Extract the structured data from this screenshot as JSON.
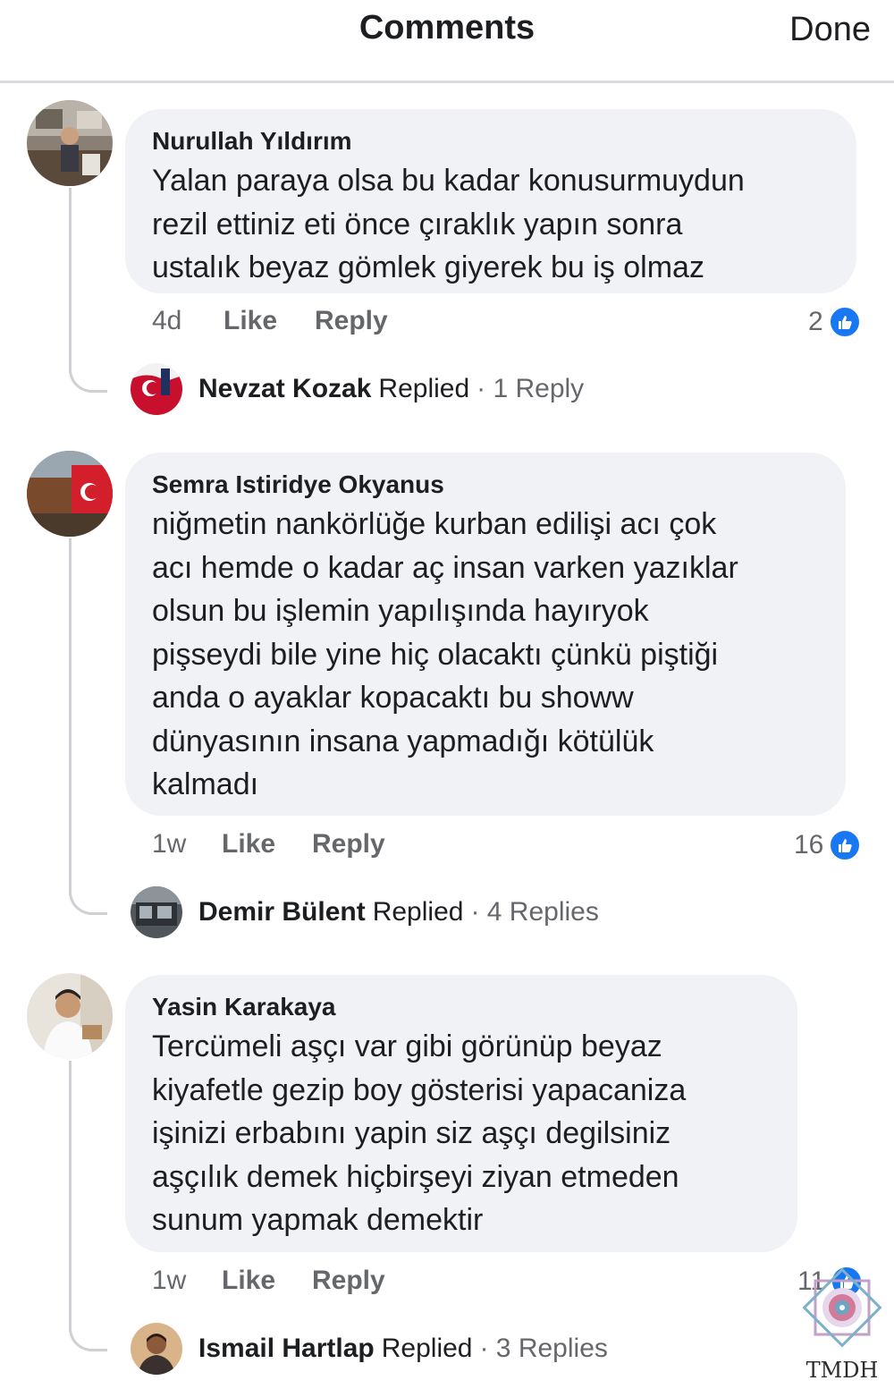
{
  "header": {
    "title": "Comments",
    "done_label": "Done"
  },
  "comments": [
    {
      "author": "Nurullah Yıldırım",
      "text": "Yalan paraya olsa bu kadar konusurmuydun\nrezil ettiniz eti önce çıraklık yapın sonra\nustalık beyaz gömlek giyerek bu iş olmaz",
      "time": "4d",
      "like_label": "Like",
      "reply_label": "Reply",
      "reaction_count": "2",
      "reply_preview": {
        "name": "Nevzat Kozak",
        "verb": "Replied",
        "count": "· 1 Reply"
      }
    },
    {
      "author": "Semra Istiridye Okyanus",
      "text": "niğmetin nankörlüğe kurban edilişi acı çok\nacı hemde o kadar aç insan varken yazıklar\nolsun bu işlemin yapılışında hayıryok\npişseydi bile yine hiç olacaktı çünkü piştiği\nanda o ayaklar kopacaktı bu showw\ndünyasının  insana yapmadığı kötülük\nkalmadı",
      "time": "1w",
      "like_label": "Like",
      "reply_label": "Reply",
      "reaction_count": "16",
      "reply_preview": {
        "name": "Demir Bülent",
        "verb": "Replied",
        "count": "· 4 Replies"
      }
    },
    {
      "author": "Yasin Karakaya",
      "text": "Tercümeli aşçı var gibi görünüp  beyaz\nkiyafetle gezip boy gösterisi yapacaniza\nişinizi erbabını yapin siz aşçı degilsiniz\naşçılık demek hiçbirşeyi ziyan etmeden\nsunum yapmak demektir",
      "time": "1w",
      "like_label": "Like",
      "reply_label": "Reply",
      "reaction_count": "11",
      "reply_preview": {
        "name": "Ismail Hartlap",
        "verb": "Replied",
        "count": "· 3 Replies"
      }
    }
  ],
  "watermark": {
    "text": "TMDH"
  },
  "colors": {
    "like_blue": "#1877f2",
    "bubble_bg": "#f0f2f5",
    "secondary_text": "#65676b"
  }
}
